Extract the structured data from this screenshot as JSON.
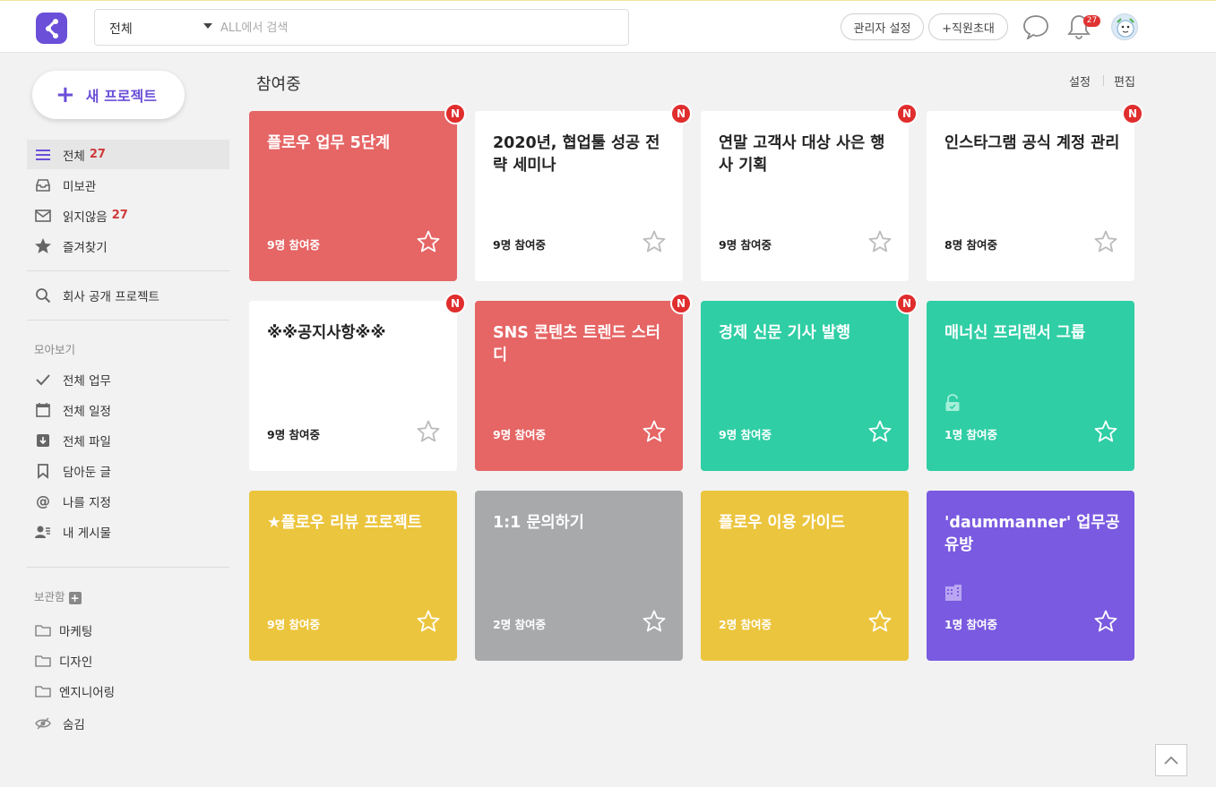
{
  "header": {
    "search_scope": "전체",
    "search_placeholder": "ALL에서 검색",
    "admin_settings": "관리자 설정",
    "invite_staff": "+직원초대",
    "notification_count": "27"
  },
  "sidebar": {
    "new_project": "새 프로젝트",
    "items": [
      {
        "label": "전체",
        "count": "27",
        "icon": "list-icon"
      },
      {
        "label": "미보관",
        "icon": "inbox-icon"
      },
      {
        "label": "읽지않음",
        "count": "27",
        "icon": "mail-icon"
      },
      {
        "label": "즐겨찾기",
        "icon": "star-icon"
      }
    ],
    "company_projects": "회사 공개 프로젝트",
    "collect_label": "모아보기",
    "collect_items": [
      {
        "label": "전체 업무",
        "icon": "check-icon"
      },
      {
        "label": "전체 일정",
        "icon": "calendar-icon"
      },
      {
        "label": "전체 파일",
        "icon": "file-box-icon"
      },
      {
        "label": "담아둔 글",
        "icon": "bookmark-icon"
      },
      {
        "label": "나를 지정",
        "icon": "at-icon"
      },
      {
        "label": "내 게시물",
        "icon": "user-post-icon"
      }
    ],
    "storage_label": "보관함",
    "folders": [
      {
        "label": "마케팅"
      },
      {
        "label": "디자인"
      },
      {
        "label": "엔지니어링"
      }
    ],
    "hidden": "숨김"
  },
  "main": {
    "title": "참여중",
    "settings": "설정",
    "edit": "편집",
    "projects": [
      {
        "title": "플로우 업무 5단계",
        "members": "9명 참여중",
        "color": "#e66565",
        "new": true,
        "badge": "N"
      },
      {
        "title": "2020년, 협업툴 성공 전략 세미나",
        "members": "9명 참여중",
        "color": "#ffffff",
        "new": true,
        "badge": "N"
      },
      {
        "title": "연말 고객사 대상 사은 행사 기획",
        "members": "9명 참여중",
        "color": "#ffffff",
        "new": true,
        "badge": "N"
      },
      {
        "title": "인스타그램 공식 계정 관리",
        "members": "8명 참여중",
        "color": "#ffffff",
        "new": true,
        "badge": "N"
      },
      {
        "title": "※※공지사항※※",
        "members": "9명 참여중",
        "color": "#ffffff",
        "new": true,
        "badge": "N"
      },
      {
        "title": "SNS 콘텐츠 트렌드 스터디",
        "members": "9명 참여중",
        "color": "#e66565",
        "new": true,
        "badge": "N"
      },
      {
        "title": "경제 신문 기사 발행",
        "members": "9명 참여중",
        "color": "#2fcea5",
        "new": true,
        "badge": "N"
      },
      {
        "title": "매너신 프리랜서 그룹",
        "members": "1명 참여중",
        "color": "#2fcea5",
        "new": false,
        "icon": "lock-icon"
      },
      {
        "title": "★플로우 리뷰 프로젝트",
        "members": "9명 참여중",
        "color": "#ecc53e",
        "new": false
      },
      {
        "title": "1:1 문의하기",
        "members": "2명 참여중",
        "color": "#a8a9ab",
        "new": false
      },
      {
        "title": "플로우 이용 가이드",
        "members": "2명 참여중",
        "color": "#ecc53e",
        "new": false
      },
      {
        "title": "'daummanner' 업무공유방",
        "members": "1명 참여중",
        "color": "#7a5ae0",
        "new": false,
        "icon": "building-icon"
      }
    ]
  }
}
